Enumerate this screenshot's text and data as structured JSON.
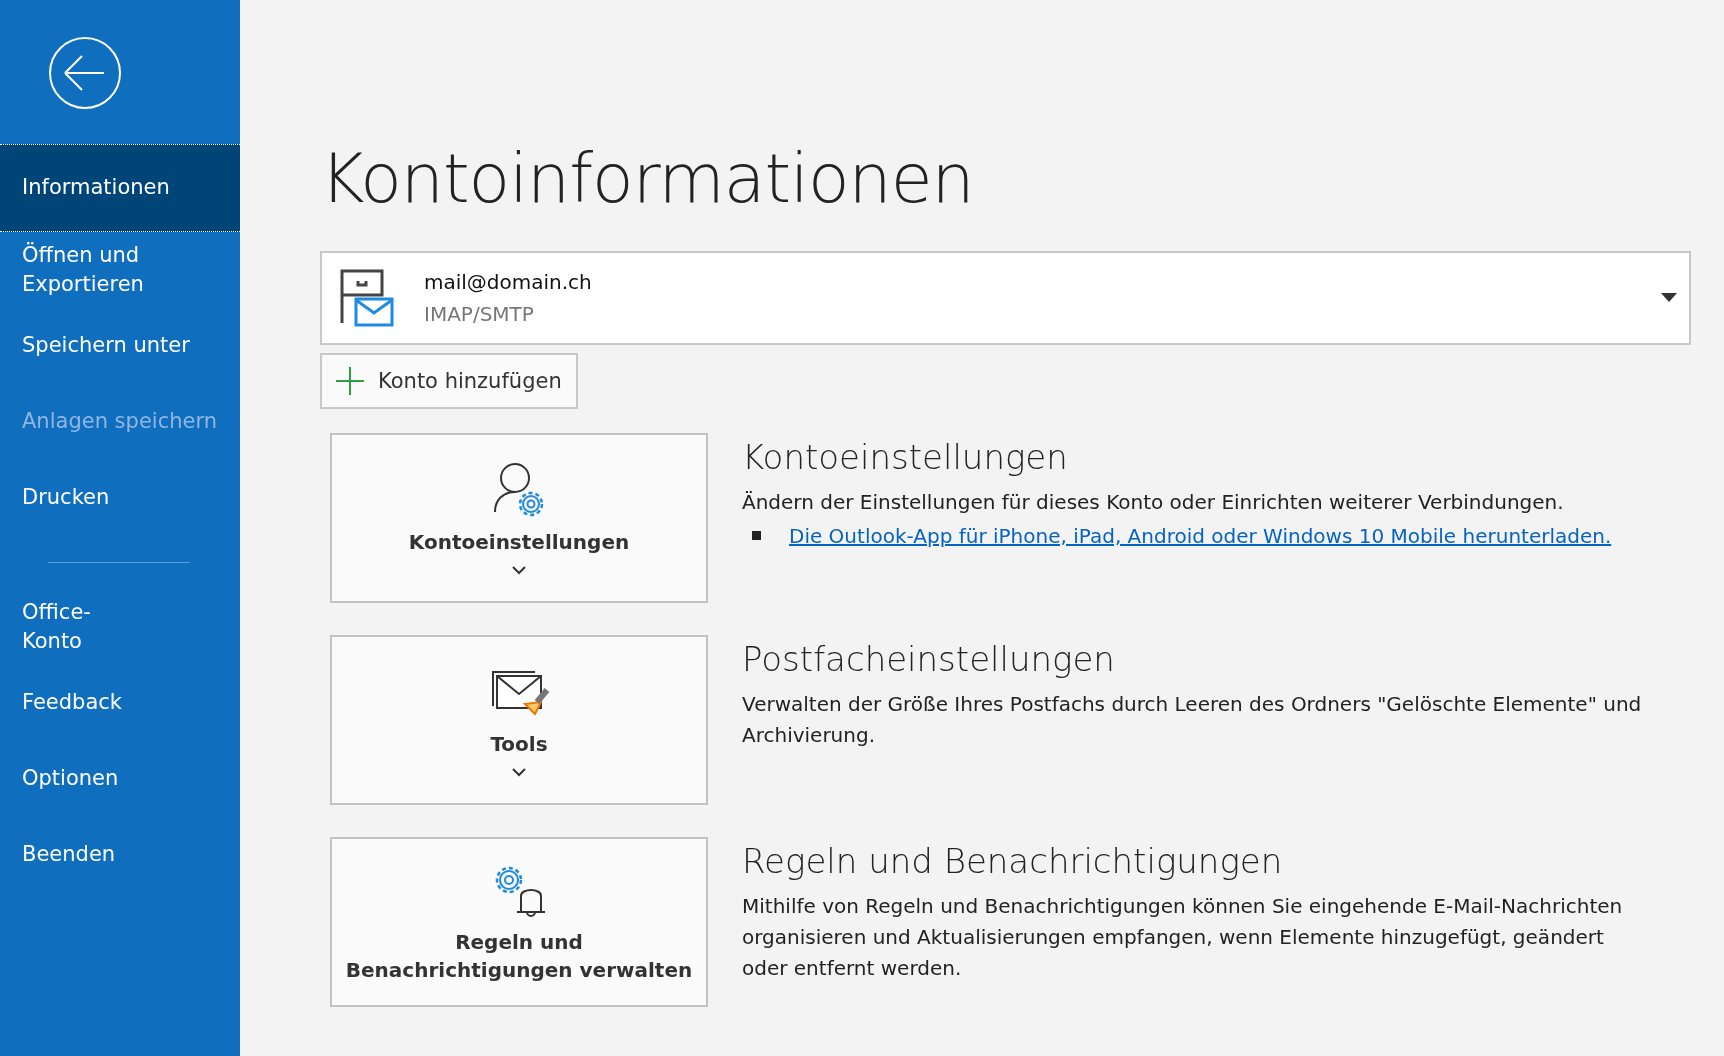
{
  "sidebar": {
    "items": [
      {
        "kind": "item",
        "label": "Informationen",
        "selected": true,
        "disabled": false
      },
      {
        "kind": "item",
        "label": "Öffnen und\nExportieren",
        "selected": false,
        "disabled": false
      },
      {
        "kind": "item",
        "label": "Speichern unter",
        "selected": false,
        "disabled": false
      },
      {
        "kind": "item",
        "label": "Anlagen speichern",
        "selected": false,
        "disabled": true
      },
      {
        "kind": "item",
        "label": "Drucken",
        "selected": false,
        "disabled": false
      },
      {
        "kind": "separator"
      },
      {
        "kind": "item",
        "label": "Office-\nKonto",
        "selected": false,
        "disabled": false
      },
      {
        "kind": "item",
        "label": "Feedback",
        "selected": false,
        "disabled": false
      },
      {
        "kind": "item",
        "label": "Optionen",
        "selected": false,
        "disabled": false
      },
      {
        "kind": "item",
        "label": "Beenden",
        "selected": false,
        "disabled": false
      }
    ]
  },
  "page_title": "Kontoinformationen",
  "account": {
    "email": "mail@domain.ch",
    "type": "IMAP/SMTP"
  },
  "add_account_button": "Konto hinzufügen",
  "sections": [
    {
      "kind": "account-settings",
      "button": "Kontoeinstellungen",
      "dropdown": true,
      "heading": "Kontoeinstellungen",
      "description": "Ändern der Einstellungen für dieses Konto oder Einrichten weiterer Verbindungen.",
      "link": "Die Outlook-App für iPhone, iPad, Android oder Windows 10 Mobile herunterladen."
    },
    {
      "kind": "tools",
      "button": "Tools",
      "dropdown": true,
      "heading": "Postfacheinstellungen",
      "description": "Verwalten der Größe Ihres Postfachs durch Leeren des Ordners \"Gelöschte Elemente\" und Archivierung."
    },
    {
      "kind": "rules",
      "button": "Regeln und\nBenachrichtigungen verwalten",
      "dropdown": false,
      "heading": "Regeln und Benachrichtigungen",
      "description": "Mithilfe von Regeln und Benachrichtigungen können Sie eingehende E-Mail-Nachrichten organisieren und Aktualisierungen empfangen, wenn Elemente hinzugefügt, geändert oder entfernt werden."
    }
  ]
}
